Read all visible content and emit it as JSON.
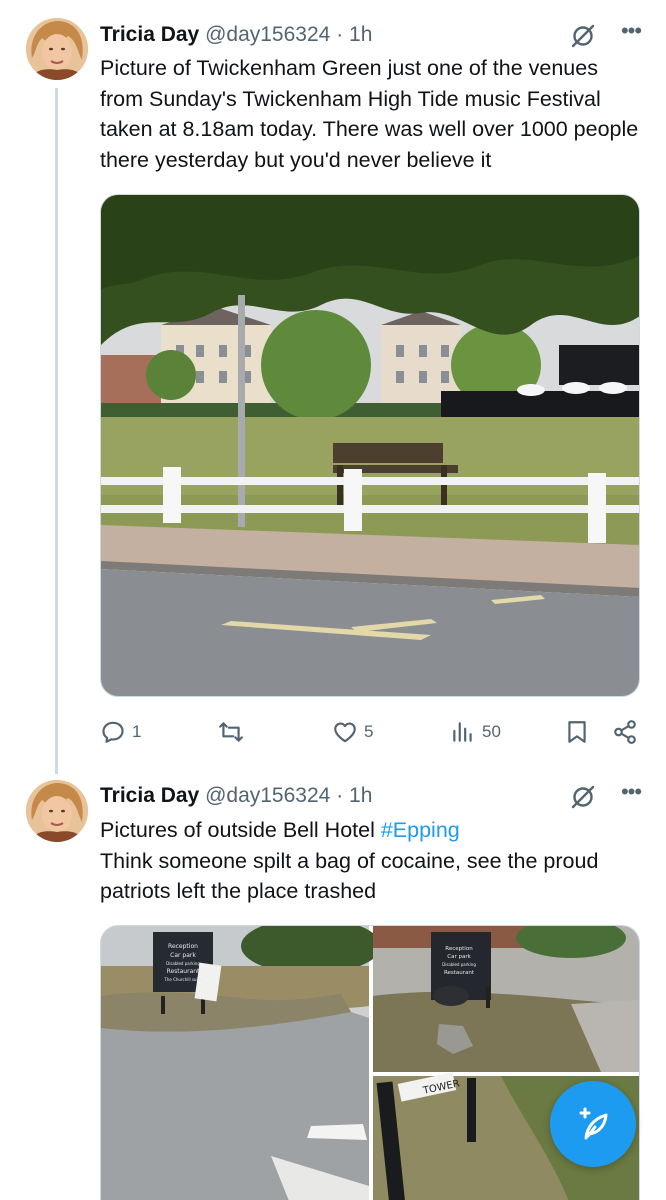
{
  "tweets": [
    {
      "name": "Tricia Day",
      "handle": "@day156324",
      "separator": "·",
      "time": "1h",
      "text": "Picture of Twickenham Green just one of the venues from Sunday's Twickenham High Tide music Festival taken at 8.18am today. There was well over 1000 people there yesterday but you'd never believe it",
      "stats": {
        "replies": "1",
        "reposts": "",
        "likes": "5",
        "views": "50"
      }
    },
    {
      "name": "Tricia Day",
      "handle": "@day156324",
      "separator": "·",
      "time": "1h",
      "text_before": "Pictures of outside Bell Hotel ",
      "hashtag": "#Epping",
      "text_after": "Think someone spilt a bag of cocaine, see the proud patriots left the place trashed"
    }
  ],
  "media_text": {
    "sign_lines": [
      "Reception",
      "Car park",
      "Disabled parking",
      "Restaurant",
      "The Churchill suite"
    ],
    "street_sign": "TOWER"
  },
  "icons": {
    "reply": "reply-icon",
    "repost": "repost-icon",
    "like": "heart-icon",
    "views": "views-icon",
    "bookmark": "bookmark-icon",
    "share": "share-icon",
    "grok": "grok-icon",
    "more": "more-icon",
    "compose": "compose-icon"
  },
  "colors": {
    "accent": "#1d9bf0",
    "secondary_text": "#536471",
    "divider": "#cfd9de"
  }
}
